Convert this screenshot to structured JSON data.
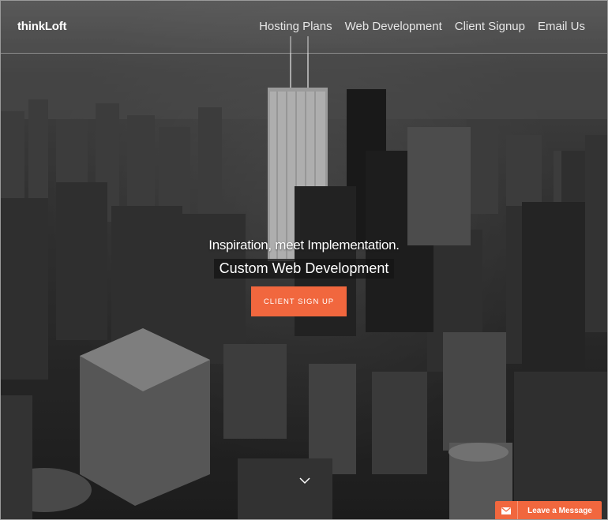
{
  "brand": "thinkLoft",
  "nav": {
    "items": [
      {
        "label": "Hosting Plans"
      },
      {
        "label": "Web Development"
      },
      {
        "label": "Client Signup"
      },
      {
        "label": "Email Us"
      }
    ]
  },
  "hero": {
    "tagline": "Inspiration, meet Implementation.",
    "title": "Custom Web Development",
    "cta_label": "CLIENT SIGN UP"
  },
  "chat": {
    "label": "Leave a Message",
    "icon": "envelope-icon"
  },
  "colors": {
    "accent": "#f1673e",
    "text": "#ffffff"
  }
}
